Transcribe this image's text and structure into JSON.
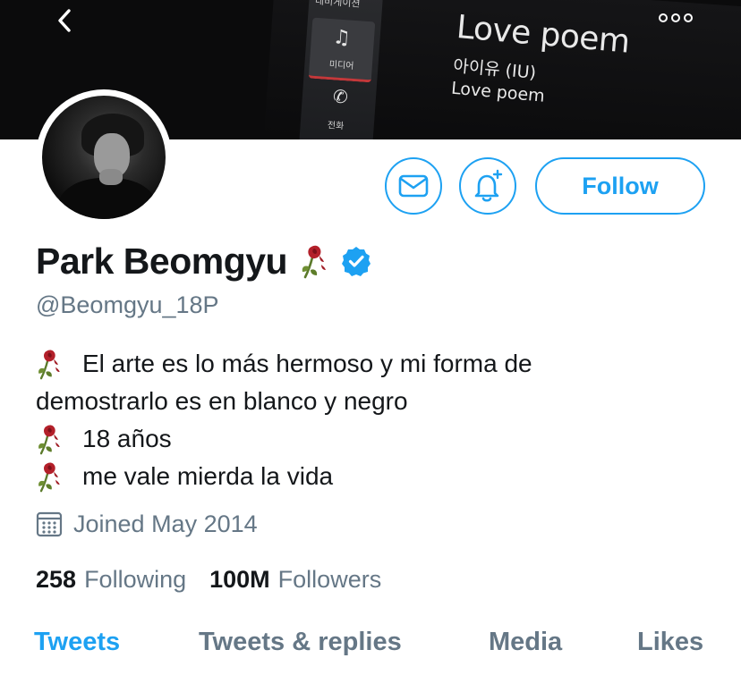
{
  "banner": {
    "side_top_label": "네비게이션",
    "media_label": "미디어",
    "phone_label": "전화",
    "song_title": "Love poem",
    "song_artist": "아이유 (IU)",
    "song_album": "Love poem"
  },
  "header": {
    "back_icon": "chevron-left-icon",
    "more_icon": "more-options-icon"
  },
  "actions": {
    "message_icon": "mail-icon",
    "notify_icon": "bell-plus-icon",
    "follow_label": "Follow"
  },
  "profile": {
    "name": "Park Beomgyu",
    "handle": "@Beomgyu_18P",
    "verified": true,
    "bio_lines": [
      {
        "emoji": "🥀",
        "text": "El arte es lo más hermoso y mi forma de"
      },
      {
        "emoji": "",
        "text": "demostrarlo es en blanco y negro"
      },
      {
        "emoji": "🥀",
        "text": "18 años"
      },
      {
        "emoji": "🥀",
        "text": "me vale mierda la vida"
      }
    ],
    "joined": "Joined May 2014"
  },
  "stats": {
    "following_count": "258",
    "following_label": "Following",
    "followers_count": "100M",
    "followers_label": "Followers"
  },
  "tabs": [
    {
      "label": "Tweets",
      "active": true
    },
    {
      "label": "Tweets & replies",
      "active": false
    },
    {
      "label": "Media",
      "active": false
    },
    {
      "label": "Likes",
      "active": false
    }
  ],
  "colors": {
    "accent": "#1da1f2",
    "secondary_text": "#657786",
    "primary_text": "#14171a"
  }
}
